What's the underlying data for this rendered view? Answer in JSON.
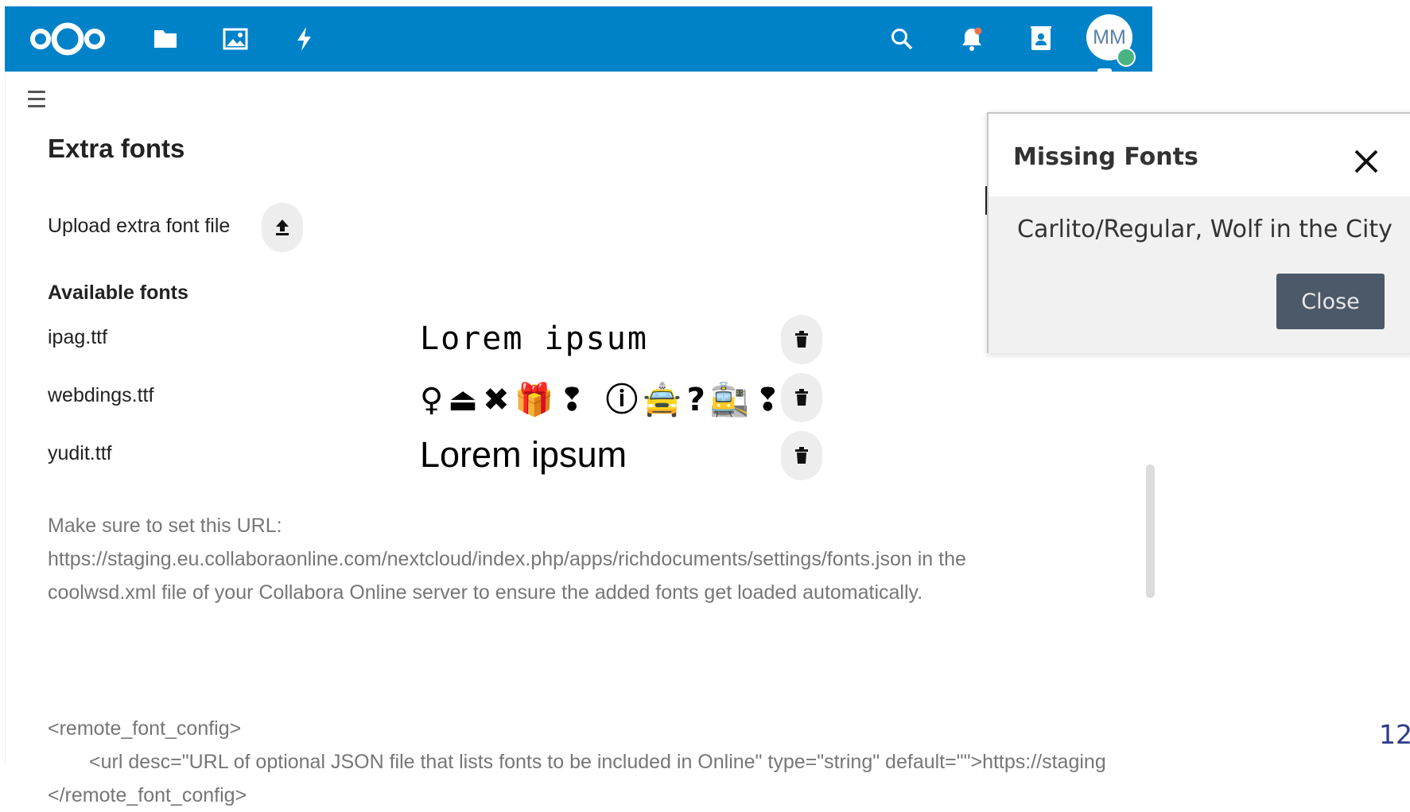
{
  "topbar": {
    "bg_color": "#0082c9",
    "logo": "nextcloud-logo-icon",
    "apps": [
      "folder-icon",
      "image-icon",
      "lightning-icon"
    ],
    "header_icons": [
      "search-icon",
      "bell-icon",
      "contacts-icon"
    ],
    "avatar_initials": "MM",
    "status_color": "#49b382"
  },
  "settings": {
    "title": "Extra fonts",
    "upload_label": "Upload extra font file",
    "available_title": "Available fonts",
    "fonts": [
      {
        "name": "ipag.ttf",
        "preview": "Lorem ipsum"
      },
      {
        "name": "webdings.ttf",
        "preview": "♀⏏✖🎁❢ ⓘ🚖?🚉❢"
      },
      {
        "name": "yudit.ttf",
        "preview": "Lorem ipsum"
      }
    ],
    "note_line1": "Make sure to set this URL:",
    "note_line2": "https://staging.eu.collaboraonline.com/nextcloud/index.php/apps/richdocuments/settings/fonts.json in the",
    "note_line3": "coolwsd.xml file of your Collabora Online server to ensure the added fonts get loaded automatically.",
    "code_open": "<remote_font_config>",
    "code_url": "<url desc=\"URL of optional JSON file that lists fonts to be included in Online\" type=\"string\" default=\"\">https://staging",
    "code_close": "</remote_font_config>"
  },
  "dialog": {
    "title": "Missing Fonts",
    "message": "Carlito/Regular, Wolf in the City",
    "close_button": "Close"
  },
  "page_number": "12"
}
